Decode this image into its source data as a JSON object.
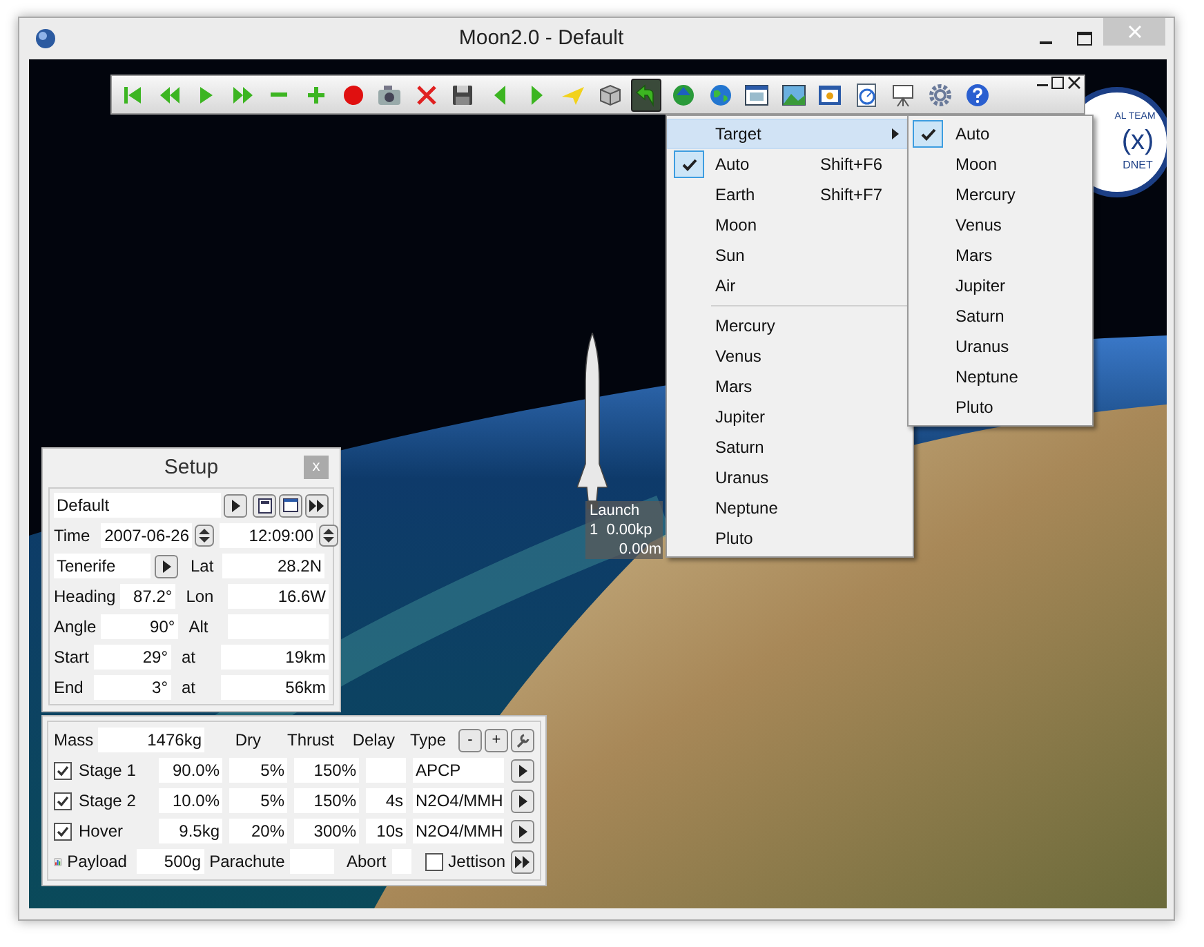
{
  "window": {
    "title": "Moon2.0 - Default"
  },
  "toolbar": {
    "buttons": [
      {
        "kind": "first",
        "selected": false
      },
      {
        "kind": "rewind",
        "selected": false
      },
      {
        "kind": "play",
        "selected": false
      },
      {
        "kind": "forward",
        "selected": false
      },
      {
        "kind": "minus",
        "selected": false
      },
      {
        "kind": "plus",
        "selected": false
      },
      {
        "kind": "record",
        "selected": false
      },
      {
        "kind": "camera",
        "selected": false
      },
      {
        "kind": "delete",
        "selected": false
      },
      {
        "kind": "save",
        "selected": false
      },
      {
        "kind": "left",
        "selected": false
      },
      {
        "kind": "right",
        "selected": false
      },
      {
        "kind": "plane",
        "selected": false
      },
      {
        "kind": "cube",
        "selected": false
      },
      {
        "kind": "arrow",
        "selected": true
      },
      {
        "kind": "globe-up",
        "selected": false
      },
      {
        "kind": "globe",
        "selected": false
      },
      {
        "kind": "window",
        "selected": false
      },
      {
        "kind": "image",
        "selected": false
      },
      {
        "kind": "panel",
        "selected": false
      },
      {
        "kind": "gauge",
        "selected": false
      },
      {
        "kind": "easel",
        "selected": false
      },
      {
        "kind": "gear",
        "selected": false
      },
      {
        "kind": "help",
        "selected": false
      }
    ]
  },
  "menu": {
    "items": [
      {
        "kind": "submenu",
        "label": "Target",
        "checked": false,
        "selected": true
      },
      {
        "kind": "item",
        "label": "Auto",
        "shortcut": "Shift+F6",
        "checked": true,
        "selected": false
      },
      {
        "kind": "item",
        "label": "Earth",
        "shortcut": "Shift+F7",
        "checked": false,
        "selected": false
      },
      {
        "kind": "item",
        "label": "Moon",
        "checked": false,
        "selected": false
      },
      {
        "kind": "item",
        "label": "Sun",
        "checked": false,
        "selected": false
      },
      {
        "kind": "item",
        "label": "Air",
        "checked": false,
        "selected": false
      },
      {
        "kind": "separator"
      },
      {
        "kind": "item",
        "label": "Mercury",
        "checked": false,
        "selected": false
      },
      {
        "kind": "item",
        "label": "Venus",
        "checked": false,
        "selected": false
      },
      {
        "kind": "item",
        "label": "Mars",
        "checked": false,
        "selected": false
      },
      {
        "kind": "item",
        "label": "Jupiter",
        "checked": false,
        "selected": false
      },
      {
        "kind": "item",
        "label": "Saturn",
        "checked": false,
        "selected": false
      },
      {
        "kind": "item",
        "label": "Uranus",
        "checked": false,
        "selected": false
      },
      {
        "kind": "item",
        "label": "Neptune",
        "checked": false,
        "selected": false
      },
      {
        "kind": "item",
        "label": "Pluto",
        "checked": false,
        "selected": false
      }
    ]
  },
  "submenu": {
    "items": [
      {
        "label": "Auto",
        "checked": true
      },
      {
        "label": "Moon",
        "checked": false
      },
      {
        "label": "Mercury",
        "checked": false
      },
      {
        "label": "Venus",
        "checked": false
      },
      {
        "label": "Mars",
        "checked": false
      },
      {
        "label": "Jupiter",
        "checked": false
      },
      {
        "label": "Saturn",
        "checked": false
      },
      {
        "label": "Uranus",
        "checked": false
      },
      {
        "label": "Neptune",
        "checked": false
      },
      {
        "label": "Pluto",
        "checked": false
      }
    ]
  },
  "logo": {
    "top": "AL TEAM",
    "mark": "(x)",
    "bottom": "DNET"
  },
  "launch_label": {
    "lines": [
      "Launch",
      "1  0.00kp",
      "0.00m"
    ]
  },
  "setup": {
    "title": "Setup",
    "close": "x",
    "preset": "Default",
    "time_label": "Time",
    "date": "2007-06-26",
    "time": "12:09:00",
    "site": "Tenerife",
    "lat_label": "Lat",
    "lat": "28.2N",
    "params": [
      {
        "label": "Heading",
        "value": "87.2°",
        "label2": "Lon",
        "value2": "16.6W"
      },
      {
        "label": "Angle",
        "value": "90°",
        "label2": "Alt"
      },
      {
        "label": "Start",
        "value": "29°",
        "label2": "at",
        "value2": "19km"
      },
      {
        "label": "End",
        "value": "3°",
        "label2": "at",
        "value2": "56km"
      }
    ]
  },
  "stages": {
    "mass_label": "Mass",
    "mass": "1476kg",
    "columns": [
      "Dry",
      "Thrust",
      "Delay",
      "Type"
    ],
    "buttons": [
      "-",
      "+"
    ],
    "rows": [
      {
        "name": "Stage 1",
        "checked": true,
        "mass": "90.0%",
        "dry": "5%",
        "thrust": "150%",
        "type": "APCP"
      },
      {
        "name": "Stage 2",
        "checked": true,
        "mass": "10.0%",
        "dry": "5%",
        "thrust": "150%",
        "delay": "4s",
        "type": "N2O4/MMH"
      },
      {
        "name": "Hover",
        "checked": true,
        "mass": "9.5kg",
        "dry": "20%",
        "thrust": "300%",
        "delay": "10s",
        "type": "N2O4/MMH"
      }
    ],
    "payload_label": "Payload",
    "payload": "500g",
    "parachute_label": "Parachute",
    "abort_label": "Abort",
    "jettison": {
      "label": "Jettison",
      "checked": false
    }
  }
}
